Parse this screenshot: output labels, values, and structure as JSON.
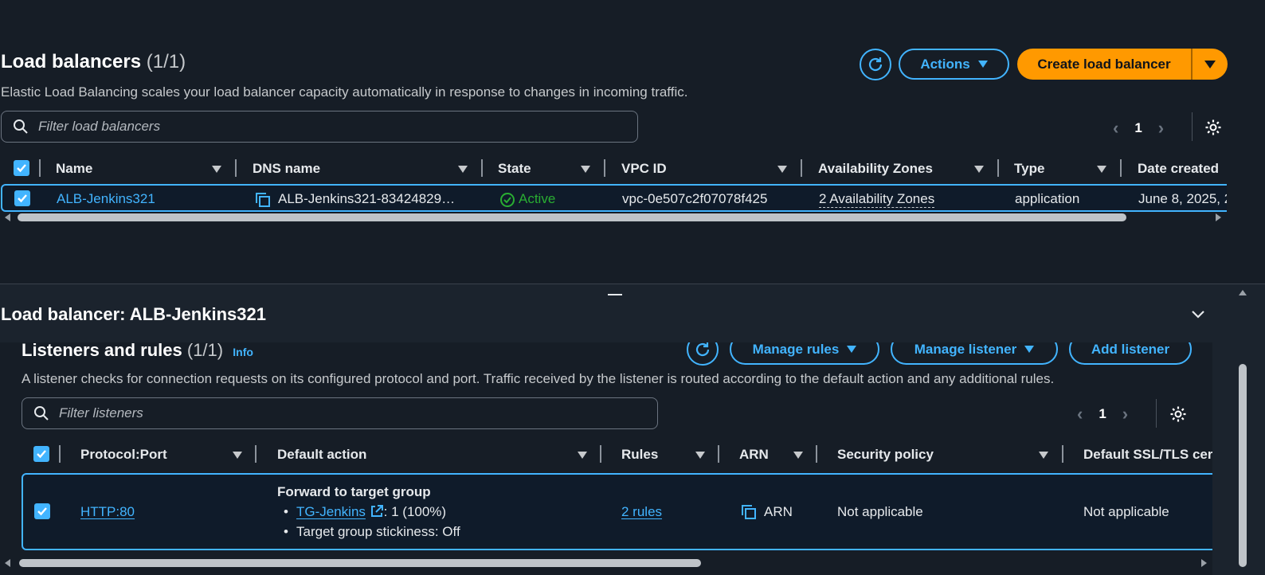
{
  "top": {
    "title": "Load balancers",
    "count": "(1/1)",
    "description": "Elastic Load Balancing scales your load balancer capacity automatically in response to changes in incoming traffic.",
    "actions_label": "Actions",
    "create_label": "Create load balancer",
    "filter_placeholder": "Filter load balancers",
    "page": "1",
    "columns": [
      "Name",
      "DNS name",
      "State",
      "VPC ID",
      "Availability Zones",
      "Type",
      "Date created"
    ],
    "row": {
      "name": "ALB-Jenkins321",
      "dns": "ALB-Jenkins321-83424829…",
      "state": "Active",
      "vpc": "vpc-0e507c2f07078f425",
      "az": "2 Availability Zones",
      "type": "application",
      "date": "June 8, 2025, 2"
    }
  },
  "detail": {
    "title": "Load balancer: ALB-Jenkins321",
    "listeners_title": "Listeners and rules",
    "listeners_count": "(1/1)",
    "info": "Info",
    "manage_rules": "Manage rules",
    "manage_listener": "Manage listener",
    "add_listener": "Add listener",
    "description": "A listener checks for connection requests on its configured protocol and port. Traffic received by the listener is routed according to the default action and any additional rules.",
    "filter_placeholder": "Filter listeners",
    "page": "1",
    "columns": [
      "Protocol:Port",
      "Default action",
      "Rules",
      "ARN",
      "Security policy",
      "Default SSL/TLS cer"
    ],
    "row": {
      "protocol": "HTTP:80",
      "action_title": "Forward to target group",
      "tg_link": "TG-Jenkins",
      "tg_weight": ": 1 (100%)",
      "stickiness": "Target group stickiness: Off",
      "rules": "2 rules",
      "arn": "ARN",
      "security_policy": "Not applicable",
      "ssl": "Not applicable"
    }
  },
  "colors": {
    "accent": "#42b4ff",
    "primary": "#ff9900",
    "success": "#29ad32",
    "background": "#161d26"
  }
}
